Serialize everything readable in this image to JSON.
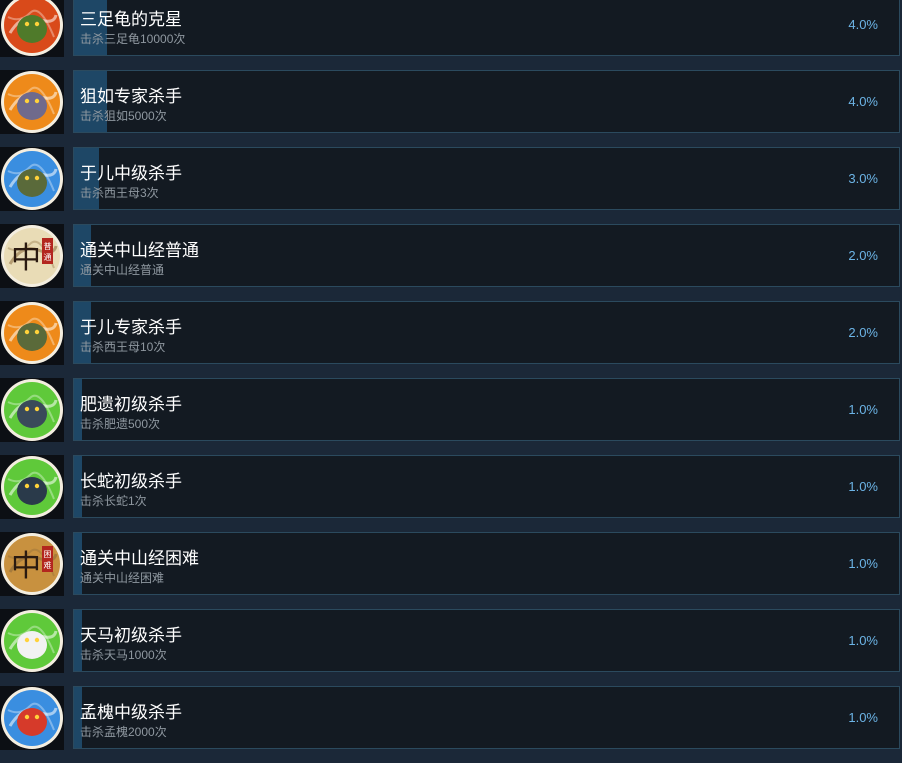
{
  "achievements": [
    {
      "title": "三足龟的克星",
      "desc": "击杀三足龟10000次",
      "percent": "4.0%",
      "percent_value": 4.0,
      "icon": "three-legged-turtle-icon",
      "icon_bg": "#d94a1a",
      "creature": "#4f7a2a"
    },
    {
      "title": "狙如专家杀手",
      "desc": "击杀狙如5000次",
      "percent": "4.0%",
      "percent_value": 4.0,
      "icon": "juru-beast-icon",
      "icon_bg": "#ee8a1a",
      "creature": "#6f6a8c"
    },
    {
      "title": "于儿中级杀手",
      "desc": "击杀西王母3次",
      "percent": "3.0%",
      "percent_value": 3.0,
      "icon": "xiwangmu-icon",
      "icon_bg": "#3a8ee0",
      "creature": "#5a6a3a"
    },
    {
      "title": "通关中山经普通",
      "desc": "通关中山经普通",
      "percent": "2.0%",
      "percent_value": 2.0,
      "icon": "zhongshan-normal-icon",
      "icon_bg": "#e9dcb6",
      "creature": "#3a2a1a",
      "glyph": "中",
      "seal": "普通"
    },
    {
      "title": "于儿专家杀手",
      "desc": "击杀西王母10次",
      "percent": "2.0%",
      "percent_value": 2.0,
      "icon": "xiwangmu-expert-icon",
      "icon_bg": "#ee8a1a",
      "creature": "#5a6a3a"
    },
    {
      "title": "肥遗初级杀手",
      "desc": "击杀肥遗500次",
      "percent": "1.0%",
      "percent_value": 1.0,
      "icon": "feiyi-serpent-icon",
      "icon_bg": "#5fc93a",
      "creature": "#3a4a5a"
    },
    {
      "title": "长蛇初级杀手",
      "desc": "击杀长蛇1次",
      "percent": "1.0%",
      "percent_value": 1.0,
      "icon": "long-snake-icon",
      "icon_bg": "#5fc93a",
      "creature": "#2a3a4a"
    },
    {
      "title": "通关中山经困难",
      "desc": "通关中山经困难",
      "percent": "1.0%",
      "percent_value": 1.0,
      "icon": "zhongshan-hard-icon",
      "icon_bg": "#c8913f",
      "creature": "#2a1a10",
      "glyph": "中",
      "seal": "困难"
    },
    {
      "title": "天马初级杀手",
      "desc": "击杀天马1000次",
      "percent": "1.0%",
      "percent_value": 1.0,
      "icon": "tianma-horse-icon",
      "icon_bg": "#5fc93a",
      "creature": "#f2f2f2"
    },
    {
      "title": "孟槐中级杀手",
      "desc": "击杀孟槐2000次",
      "percent": "1.0%",
      "percent_value": 1.0,
      "icon": "menghuai-beast-icon",
      "icon_bg": "#3a8ee0",
      "creature": "#d63a2a"
    }
  ],
  "colors": {
    "page_bg": "#1b2838",
    "card_bg": "#131a22",
    "card_border": "#2b4a5e",
    "progress_fill": "#1e4766",
    "title_text": "#ffffff",
    "desc_text": "#8f98a0",
    "percent_text": "#6cb4e6"
  }
}
